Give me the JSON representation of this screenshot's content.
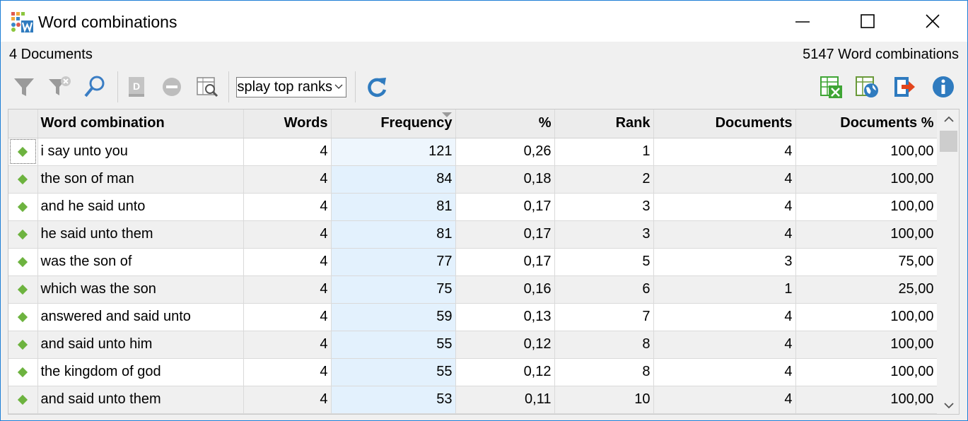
{
  "window": {
    "title": "Word combinations",
    "icon": "wordstat-app-icon"
  },
  "info": {
    "documents": "4 Documents",
    "combinations": "5147 Word combinations"
  },
  "toolbar": {
    "icons": [
      "filter-icon",
      "clear-filter-icon",
      "search-icon",
      "dictionary-icon",
      "remove-icon",
      "search-table-icon",
      "refresh-icon",
      "excel-export-icon",
      "web-export-icon",
      "send-icon",
      "info-icon"
    ],
    "rank_select_value": "Display top ranks",
    "colors": {
      "accent": "#1e7fd6",
      "excel": "#3fa535",
      "send": "#e2451d"
    }
  },
  "grid": {
    "columns": [
      "Word combination",
      "Words",
      "Frequency",
      "%",
      "Rank",
      "Documents",
      "Documents %"
    ],
    "sorted_column": "Frequency",
    "rows": [
      {
        "phrase": "i say unto you",
        "words": "4",
        "freq": "121",
        "pct": "0,26",
        "rank": "1",
        "docs": "4",
        "docs_pct": "100,00"
      },
      {
        "phrase": "the son of man",
        "words": "4",
        "freq": "84",
        "pct": "0,18",
        "rank": "2",
        "docs": "4",
        "docs_pct": "100,00"
      },
      {
        "phrase": "and he said unto",
        "words": "4",
        "freq": "81",
        "pct": "0,17",
        "rank": "3",
        "docs": "4",
        "docs_pct": "100,00"
      },
      {
        "phrase": "he said unto them",
        "words": "4",
        "freq": "81",
        "pct": "0,17",
        "rank": "3",
        "docs": "4",
        "docs_pct": "100,00"
      },
      {
        "phrase": "was the son of",
        "words": "4",
        "freq": "77",
        "pct": "0,17",
        "rank": "5",
        "docs": "3",
        "docs_pct": "75,00"
      },
      {
        "phrase": "which was the son",
        "words": "4",
        "freq": "75",
        "pct": "0,16",
        "rank": "6",
        "docs": "1",
        "docs_pct": "25,00"
      },
      {
        "phrase": "answered and said unto",
        "words": "4",
        "freq": "59",
        "pct": "0,13",
        "rank": "7",
        "docs": "4",
        "docs_pct": "100,00"
      },
      {
        "phrase": "and said unto him",
        "words": "4",
        "freq": "55",
        "pct": "0,12",
        "rank": "8",
        "docs": "4",
        "docs_pct": "100,00"
      },
      {
        "phrase": "the kingdom of god",
        "words": "4",
        "freq": "55",
        "pct": "0,12",
        "rank": "8",
        "docs": "4",
        "docs_pct": "100,00"
      },
      {
        "phrase": "and said unto them",
        "words": "4",
        "freq": "53",
        "pct": "0,11",
        "rank": "10",
        "docs": "4",
        "docs_pct": "100,00"
      }
    ]
  }
}
